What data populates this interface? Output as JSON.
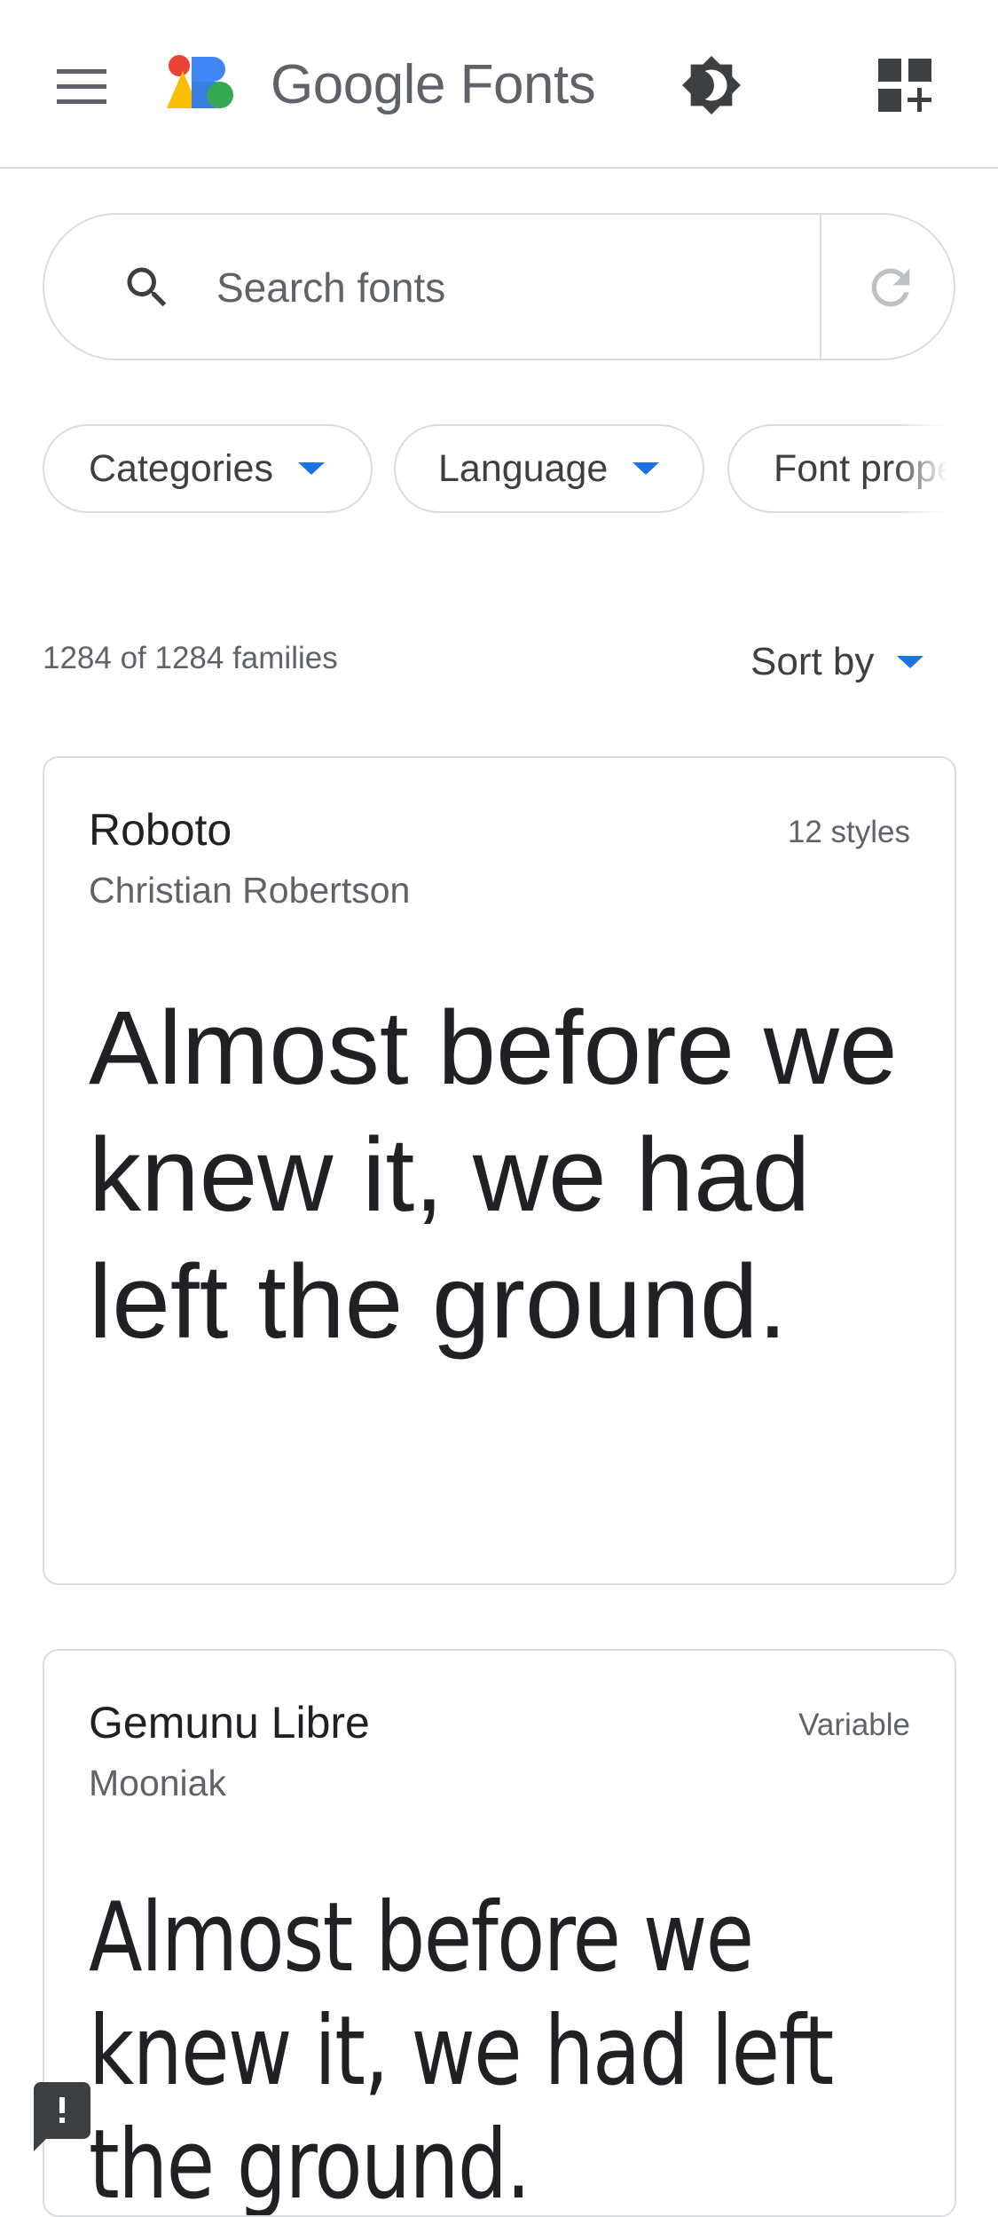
{
  "header": {
    "brand": "Google Fonts",
    "logo_colors": [
      "#ea4335",
      "#4285f4",
      "#fbbc04",
      "#34a853"
    ]
  },
  "search": {
    "placeholder": "Search fonts"
  },
  "filters": {
    "chips": [
      "Categories",
      "Language",
      "Font prope"
    ]
  },
  "results": {
    "count": "1284 of 1284 families",
    "sort_label": "Sort by"
  },
  "cards": [
    {
      "name": "Roboto",
      "author": "Christian Robertson",
      "meta": "12 styles",
      "sample": "Almost before we knew it, we had left the ground."
    },
    {
      "name": "Gemunu Libre",
      "author": "Mooniak",
      "meta": "Variable",
      "sample": "Almost before we knew it, we had left the ground."
    }
  ],
  "icons": {
    "menu": "menu-icon",
    "theme": "brightness-icon",
    "collection": "add-collection-icon",
    "search": "search-icon",
    "refresh": "refresh-icon",
    "feedback": "feedback-icon"
  },
  "colors": {
    "accent": "#1a73e8",
    "text": "#202124",
    "muted": "#5f6368",
    "border": "#dadce0"
  }
}
